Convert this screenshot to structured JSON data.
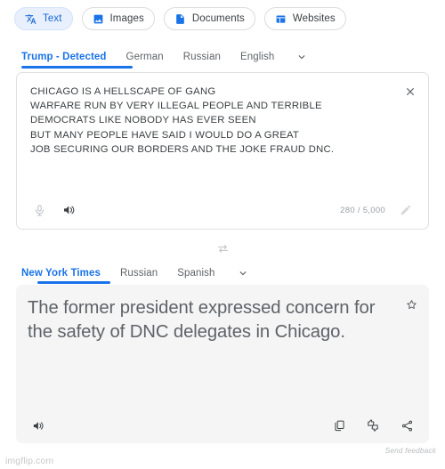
{
  "modes": [
    {
      "label": "Text",
      "icon": "translate-icon",
      "active": true
    },
    {
      "label": "Images",
      "icon": "image-icon",
      "active": false
    },
    {
      "label": "Documents",
      "icon": "document-icon",
      "active": false
    },
    {
      "label": "Websites",
      "icon": "website-icon",
      "active": false
    }
  ],
  "source": {
    "tabs": [
      {
        "label": "Trump - Detected",
        "selected": true
      },
      {
        "label": "German",
        "selected": false
      },
      {
        "label": "Russian",
        "selected": false
      },
      {
        "label": "English",
        "selected": false
      }
    ],
    "more_icon": "chevron-down-icon",
    "text": "CHICAGO IS A HELLSCAPE OF GANG\nWARFARE RUN BY VERY ILLEGAL PEOPLE AND TERRIBLE\nDEMOCRATS LIKE NOBODY HAS EVER SEEN\nBUT MANY PEOPLE HAVE SAID I WOULD DO A GREAT\nJOB SECURING OUR BORDERS AND THE JOKE FRAUD DNC.",
    "close_icon": "close-icon",
    "mic_icon": "microphone-icon",
    "listen_icon": "speaker-icon",
    "char_count": "280 / 5,000",
    "edit_icon": "pencil-icon"
  },
  "swap": {
    "icon": "swap-languages-icon"
  },
  "target": {
    "tabs": [
      {
        "label": "New York Times",
        "selected": true
      },
      {
        "label": "Russian",
        "selected": false
      },
      {
        "label": "Spanish",
        "selected": false
      }
    ],
    "more_icon": "chevron-down-icon",
    "text": "The former president expressed concern for the safety of DNC delegates in Chicago.",
    "star_icon": "star-icon",
    "listen_icon": "speaker-icon",
    "copy_icon": "copy-icon",
    "rate_icon": "thumbs-up-down-icon",
    "share_icon": "share-icon"
  },
  "footer": {
    "feedback": "Send feedback",
    "watermark": "imgflip.com"
  },
  "colors": {
    "accent": "#1a73e8",
    "active_chip_bg": "#e8f0fe",
    "output_bg": "#f5f5f5",
    "muted_text": "#5f6368"
  }
}
